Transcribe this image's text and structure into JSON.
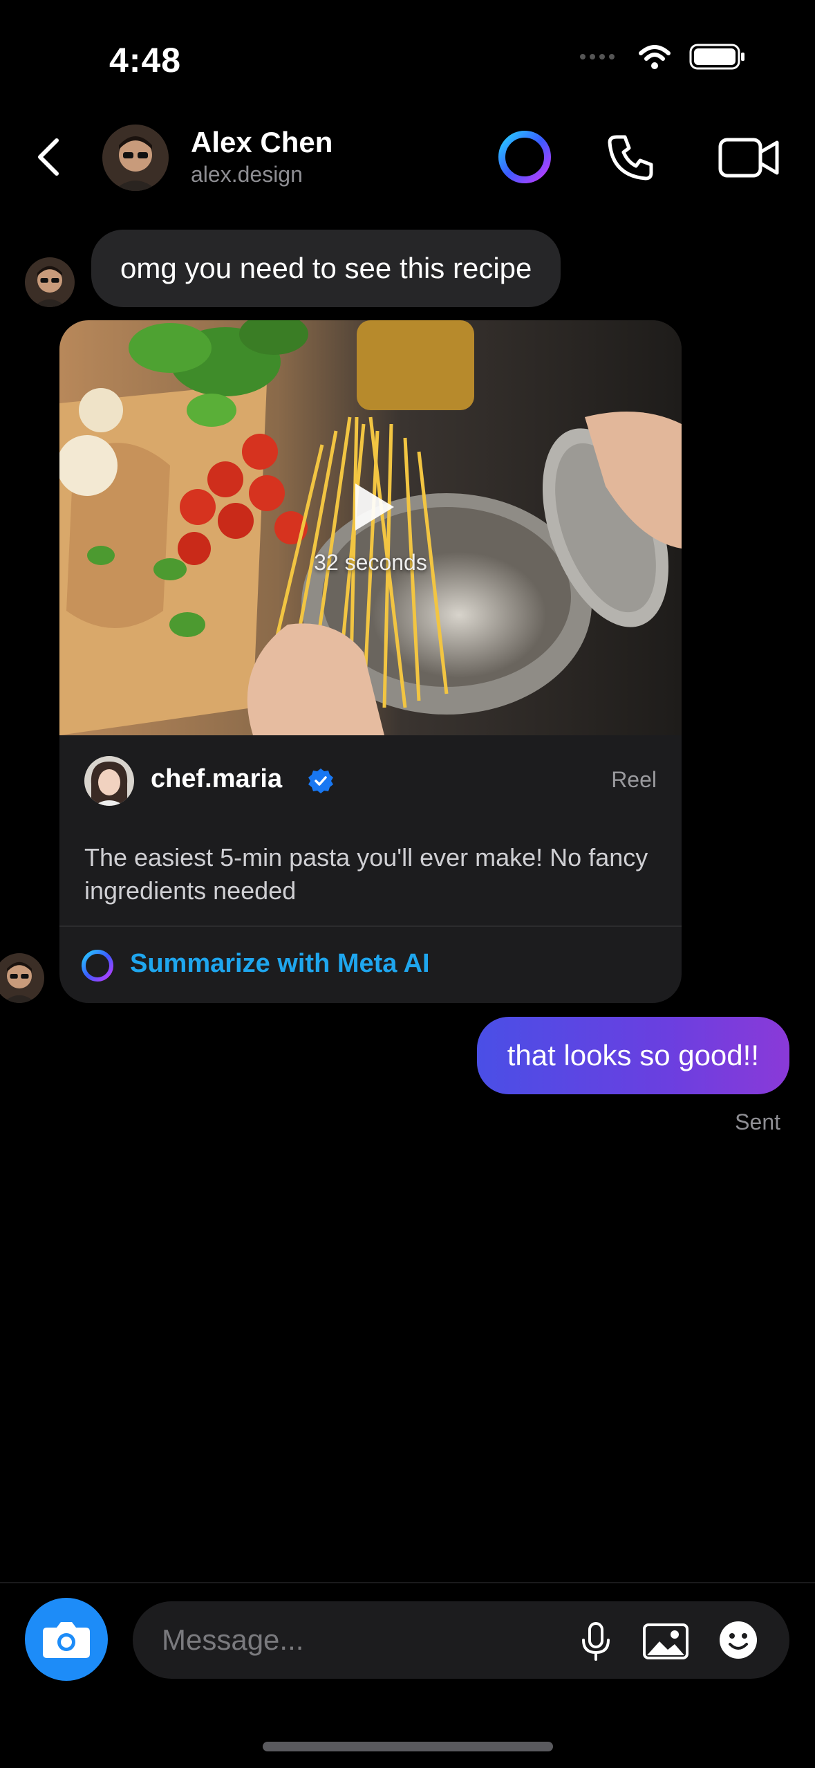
{
  "status_bar": {
    "time": "4:48",
    "icons": [
      "cellular-signal-icon",
      "wifi-icon",
      "battery-icon"
    ]
  },
  "header": {
    "back_icon": "chevron-left-icon",
    "contact_name": "Alex Chen",
    "contact_username": "alex.design",
    "actions": [
      "meta-ai-icon",
      "phone-icon",
      "video-camera-icon"
    ]
  },
  "messages": {
    "incoming_text": "omg you need to see this recipe",
    "reel": {
      "duration": "32 seconds",
      "author": "chef.maria",
      "verified": true,
      "kind": "Reel",
      "caption": "The easiest 5-min pasta you'll ever make! No fancy ingredients needed",
      "summarize_label": "Summarize with Meta AI"
    },
    "outgoing_text": "that looks so good!!",
    "outgoing_status": "Sent"
  },
  "composer": {
    "placeholder": "Message...",
    "value": "",
    "icons": [
      "camera-icon",
      "microphone-icon",
      "photo-icon",
      "emoji-icon"
    ]
  },
  "colors": {
    "background": "#000000",
    "incoming_bubble": "#262628",
    "card": "#1c1c1e",
    "outgoing_gradient_start": "#4a4fe6",
    "outgoing_gradient_end": "#8a3ad8",
    "link_blue": "#1fa6ee",
    "camera_button": "#1d8cf8",
    "verified_blue": "#1877f2"
  }
}
